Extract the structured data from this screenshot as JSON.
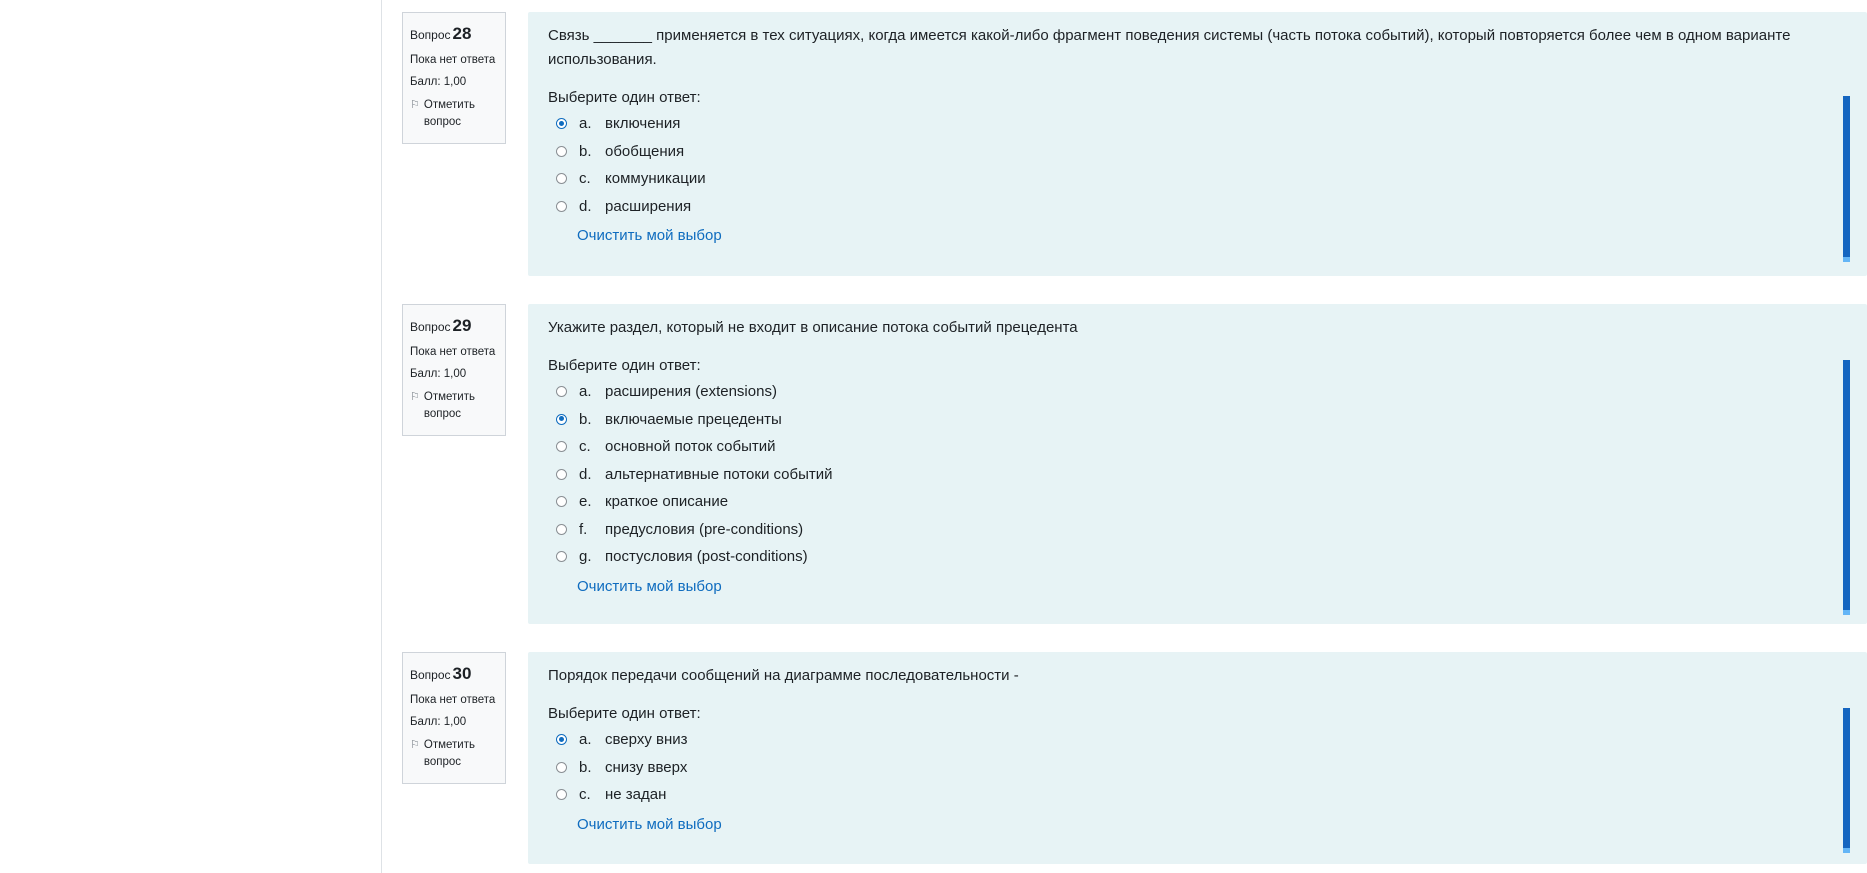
{
  "questions": [
    {
      "label": "Вопрос",
      "number": "28",
      "state": "Пока нет ответа",
      "grade": "Балл: 1,00",
      "flag_label": "Отметить вопрос",
      "text": "Связь _______ применяется в тех ситуациях, когда имеется какой-либо фрагмент поведения системы (часть потока событий), который повторяется более чем в одном варианте использования.",
      "prompt": "Выберите один ответ:",
      "answers": [
        {
          "letter": "a.",
          "text": "включения",
          "selected": true
        },
        {
          "letter": "b.",
          "text": "обобщения",
          "selected": false
        },
        {
          "letter": "c.",
          "text": "коммуникации",
          "selected": false
        },
        {
          "letter": "d.",
          "text": "расширения",
          "selected": false
        }
      ],
      "clear_label": "Очистить мой выбор"
    },
    {
      "label": "Вопрос",
      "number": "29",
      "state": "Пока нет ответа",
      "grade": "Балл: 1,00",
      "flag_label": "Отметить вопрос",
      "text": "Укажите раздел, который не входит в описание потока событий прецедента",
      "prompt": "Выберите один ответ:",
      "answers": [
        {
          "letter": "a.",
          "text": "расширения (extensions)",
          "selected": false
        },
        {
          "letter": "b.",
          "text": "включаемые прецеденты",
          "selected": true
        },
        {
          "letter": "c.",
          "text": "основной поток событий",
          "selected": false
        },
        {
          "letter": "d.",
          "text": "альтернативные потоки событий",
          "selected": false
        },
        {
          "letter": "e.",
          "text": "краткое описание",
          "selected": false
        },
        {
          "letter": "f.",
          "text": "предусловия (pre-conditions)",
          "selected": false
        },
        {
          "letter": "g.",
          "text": "постусловия (post-conditions)",
          "selected": false
        }
      ],
      "clear_label": "Очистить мой выбор"
    },
    {
      "label": "Вопрос",
      "number": "30",
      "state": "Пока нет ответа",
      "grade": "Балл: 1,00",
      "flag_label": "Отметить вопрос",
      "text": "Порядок передачи сообщений на диаграмме последовательности -",
      "prompt": "Выберите один ответ:",
      "answers": [
        {
          "letter": "a.",
          "text": "сверху вниз",
          "selected": true
        },
        {
          "letter": "b.",
          "text": "снизу вверх",
          "selected": false
        },
        {
          "letter": "c.",
          "text": "не задан",
          "selected": false
        }
      ],
      "clear_label": "Очистить мой выбор"
    }
  ],
  "colors": {
    "content_bg": "#e7f3f5",
    "accent": "#0f6cbf",
    "scroll_indicator": "#1565c0"
  }
}
